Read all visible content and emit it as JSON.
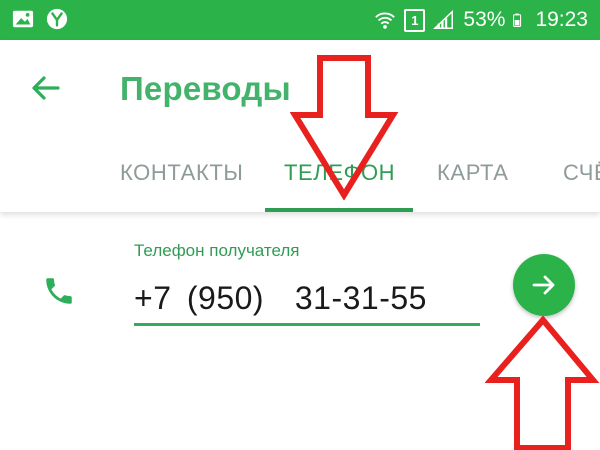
{
  "status_bar": {
    "sim_label": "1",
    "battery": "53%",
    "time": "19:23",
    "icons": [
      "image-icon",
      "yandex-icon",
      "wifi-icon",
      "sim-icon",
      "signal-icon",
      "battery-icon"
    ]
  },
  "header": {
    "title": "Переводы",
    "back_icon": "arrow-left-icon"
  },
  "tabs": [
    {
      "label": "КОНТАКТЫ",
      "active": false
    },
    {
      "label": "ТЕЛЕФОН",
      "active": true
    },
    {
      "label": "КАРТА",
      "active": false
    },
    {
      "label": "СЧЁ",
      "active": false
    }
  ],
  "form": {
    "label": "Телефон получателя",
    "phone_value": "+7 (950)  31-31-55",
    "field_icon": "phone-icon",
    "next_icon": "arrow-right-icon"
  },
  "colors": {
    "status_bar": "#2bb34a",
    "accent": "#2e9d53",
    "title": "#43b36b",
    "tab_inactive": "#8f9a9a",
    "annotation": "#e8201e"
  }
}
